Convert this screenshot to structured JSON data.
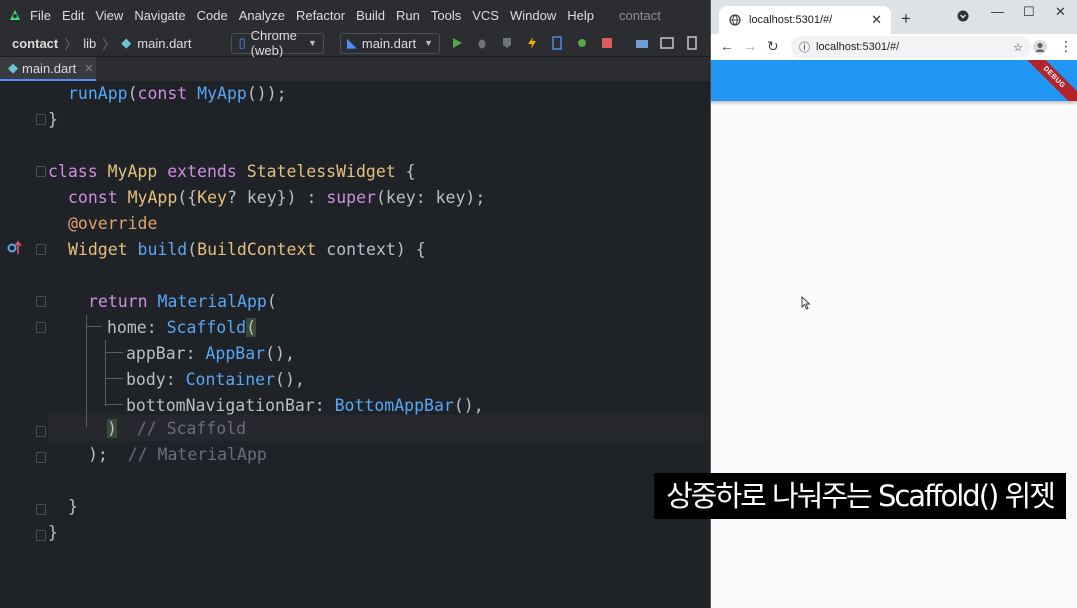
{
  "menubar": {
    "items": [
      "File",
      "Edit",
      "View",
      "Navigate",
      "Code",
      "Analyze",
      "Refactor",
      "Build",
      "Run",
      "Tools",
      "VCS",
      "Window",
      "Help"
    ],
    "project_name": "contact"
  },
  "toolbar": {
    "breadcrumb": [
      "contact",
      "lib",
      "main.dart"
    ],
    "device_selector": "Chrome (web)",
    "run_config": "main.dart"
  },
  "editor": {
    "tab_label": "main.dart",
    "code": {
      "l1": {
        "fn": "runApp",
        "p1": "(",
        "kw": "const",
        "cls": "MyApp",
        "p2": "());"
      },
      "l2": "}",
      "l4": {
        "kw1": "class",
        "cls1": "MyApp",
        "kw2": "extends",
        "cls2": "StatelessWidget",
        "p": " {"
      },
      "l5": {
        "kw": "const",
        "cls": "MyApp",
        "p1": "({",
        "cls2": "Key",
        "p2": "? key}) : ",
        "kw2": "super",
        "p3": "(key: key);"
      },
      "l6": "@override",
      "l7": {
        "cls": "Widget",
        "fn": "build",
        "p1": "(",
        "cls2": "BuildContext",
        "p2": " context) {"
      },
      "l9": {
        "kw": "return",
        "cls": "MaterialApp",
        "p": "("
      },
      "l10": {
        "prop": "home: ",
        "cls": "Scaffold",
        "p": "("
      },
      "l11": {
        "prop": "appBar: ",
        "cls": "AppBar",
        "p": "(),"
      },
      "l12": {
        "prop": "body: ",
        "cls": "Container",
        "p": "(),"
      },
      "l13": {
        "prop": "bottomNavigationBar: ",
        "cls": "BottomAppBar",
        "p": "(),"
      },
      "l14": {
        "p": ")",
        "cmt": "// Scaffold"
      },
      "l15": {
        "p": ");",
        "cmt": "// MaterialApp"
      },
      "l17": "}",
      "l18": "}"
    }
  },
  "browser": {
    "tab_title": "localhost:5301/#/",
    "url": "localhost:5301/#/",
    "debug_banner": "DEBUG",
    "appbar_color": "#2196f3"
  },
  "subtitle": "상중하로 나눠주는 Scaffold() 위젯",
  "icons": {
    "run": "play-icon",
    "debug": "bug-icon",
    "hot_reload": "lightning-icon",
    "stop": "stop-icon"
  }
}
